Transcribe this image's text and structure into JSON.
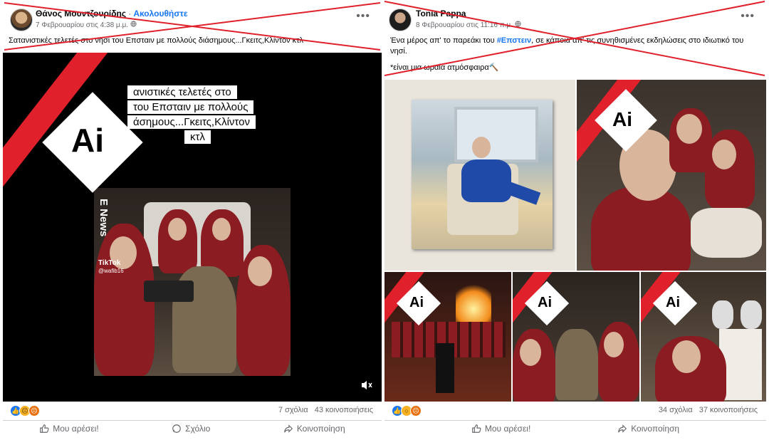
{
  "post1": {
    "author": "Θάνος Μουντζουρίδης",
    "separator": "·",
    "follow_label": "Ακολουθήστε",
    "timestamp": "7 Φεβρουαρίου στις 4:38 μ.μ.",
    "more_label": "•••",
    "text": "Σατανιστικές τελετές στο νησί του Επσταιν με πολλούς διάσημους...Γκειτς,Κλίντον κτλ",
    "overlay_caption": [
      "ανιστικές τελετές στο",
      "του Επσταιν με πολλούς",
      "άσημους...Γκειτς,Κλίντον",
      "κτλ"
    ],
    "watermark_news": "E News",
    "watermark_tiktok": "TikTok",
    "watermark_user": "@wafib16",
    "ai_badge": "Ai",
    "comments": "7 σχόλια",
    "shares": "43 κοινοποιήσεις",
    "like_label": "Μου αρέσει!",
    "comment_label": "Σχόλιο",
    "share_label": "Κοινοποίηση"
  },
  "post2": {
    "author": "Tonia Pappa",
    "timestamp": "8 Φεβρουαρίου στις 11:16 π.μ.",
    "more_label": "•••",
    "text_before": "Ένα μέρος απ' το παρεάκι του ",
    "hashtag": "#Επστειν",
    "text_after": ", σε κάποια απ' τις συνηθισμένες εκδηλώσεις στο ιδιωτικό του νησί.",
    "text_line2": "*είναι μια ωραία ατμόσφαιρα🔨",
    "ai_badge": "Ai",
    "comments": "34 σχόλια",
    "shares": "37 κοινοποιήσεις",
    "like_label": "Μου αρέσει!",
    "share_label": "Κοινοποίηση"
  },
  "colors": {
    "accent": "#1877f2",
    "cross_red": "#e0202b",
    "robe": "#8b1c22"
  },
  "icons": [
    "like-reaction-icon",
    "sad-reaction-icon",
    "angry-reaction-icon",
    "wow-reaction-icon",
    "thumbs-up-icon",
    "comment-icon",
    "share-icon",
    "mute-icon",
    "more-options-icon",
    "globe-icon"
  ]
}
